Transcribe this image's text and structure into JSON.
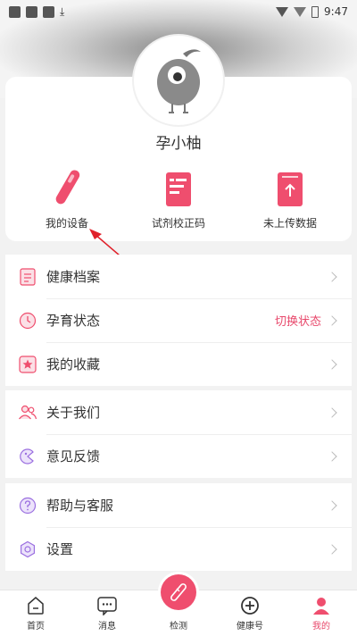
{
  "status_bar": {
    "time": "9:47"
  },
  "profile": {
    "username": "孕小柚"
  },
  "quick_actions": [
    {
      "label": "我的设备",
      "icon": "test-pen-icon"
    },
    {
      "label": "试剂校正码",
      "icon": "reagent-card-icon"
    },
    {
      "label": "未上传数据",
      "icon": "upload-document-icon"
    }
  ],
  "menu_group1": [
    {
      "label": "健康档案",
      "icon": "health-record-icon",
      "extra": ""
    },
    {
      "label": "孕育状态",
      "icon": "clock-icon",
      "extra": "切换状态"
    },
    {
      "label": "我的收藏",
      "icon": "star-favorite-icon",
      "extra": ""
    }
  ],
  "menu_group2": [
    {
      "label": "关于我们",
      "icon": "people-icon"
    },
    {
      "label": "意见反馈",
      "icon": "feedback-icon"
    }
  ],
  "menu_group3": [
    {
      "label": "帮助与客服",
      "icon": "question-icon"
    },
    {
      "label": "设置",
      "icon": "settings-icon"
    }
  ],
  "bottom_nav": [
    {
      "label": "首页",
      "icon": "home-icon"
    },
    {
      "label": "消息",
      "icon": "message-icon"
    },
    {
      "label": "检测",
      "icon": "detect-pen-icon"
    },
    {
      "label": "健康号",
      "icon": "plus-circle-icon"
    },
    {
      "label": "我的",
      "icon": "profile-icon",
      "active": true
    }
  ],
  "colors": {
    "accent": "#ef4e6e",
    "text": "#333333",
    "background": "#f2f2f2"
  }
}
